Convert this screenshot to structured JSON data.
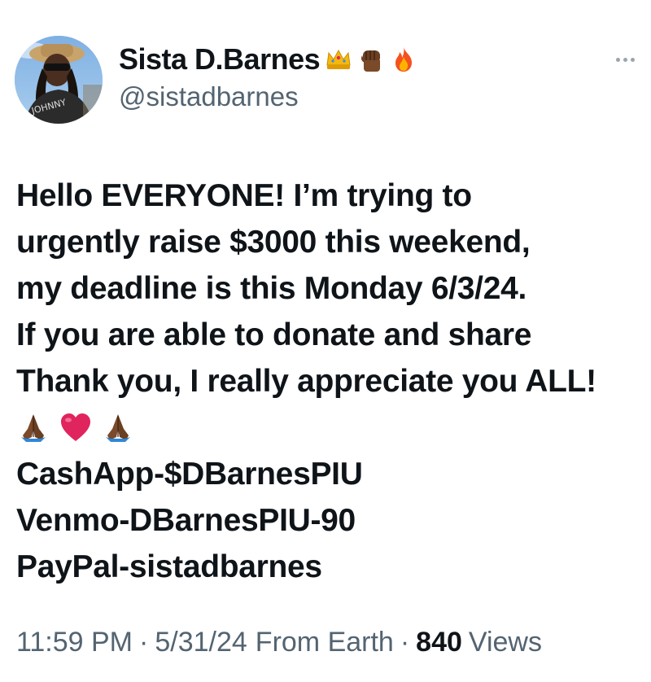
{
  "author": {
    "display_name": "Sista D.Barnes",
    "handle": "@sistadbarnes",
    "name_emojis": [
      "crown-icon",
      "raised-fist-icon",
      "fire-icon"
    ]
  },
  "more_button": {
    "icon": "more-horizontal-icon"
  },
  "tweet": {
    "lines": [
      "Hello EVERYONE! I’m trying to",
      "urgently raise $3000 this weekend,",
      "my deadline is this Monday 6/3/24.",
      "If you are able to donate and share",
      "Thank you, I really appreciate you ALL!"
    ],
    "emoji_line": [
      "folded-hands-icon",
      "red-heart-icon",
      "folded-hands-icon"
    ],
    "payment_lines": [
      "CashApp-$DBarnesPIU",
      "Venmo-DBarnesPIU-90",
      "PayPal-sistadbarnes"
    ]
  },
  "meta": {
    "time": "11:59 PM",
    "date": "5/31/24",
    "source": "From Earth",
    "separator": "·",
    "views_count": "840",
    "views_label": "Views"
  },
  "colors": {
    "text_primary": "#0f1419",
    "text_secondary": "#536471",
    "heart_red": "#e0245e"
  }
}
